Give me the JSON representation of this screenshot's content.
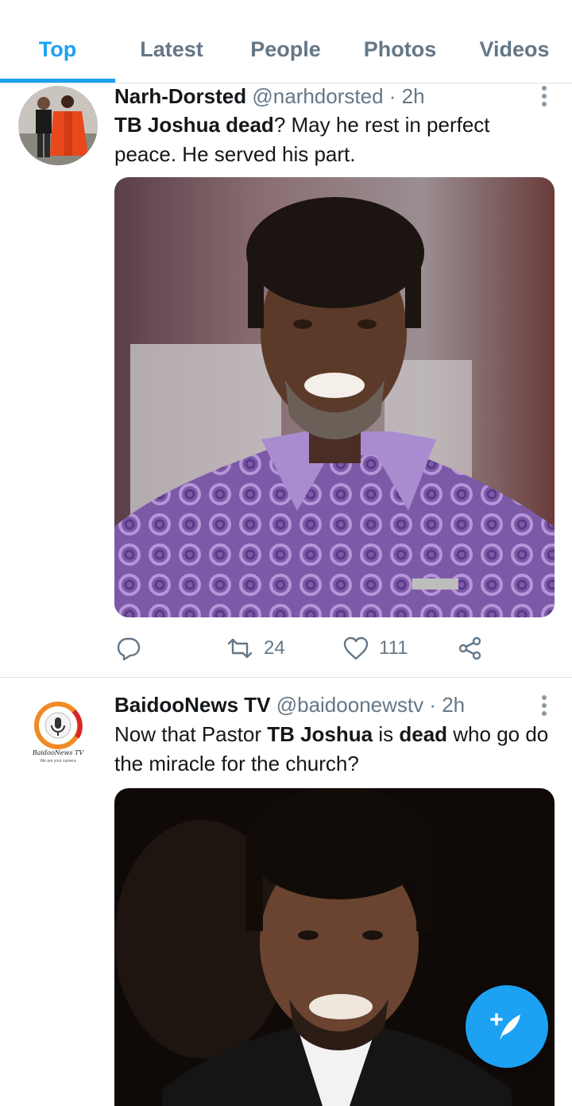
{
  "tabs": [
    {
      "label": "Top",
      "active": true
    },
    {
      "label": "Latest"
    },
    {
      "label": "People"
    },
    {
      "label": "Photos"
    },
    {
      "label": "Videos"
    }
  ],
  "tweets": [
    {
      "name": "Narh-Dorsted",
      "handle": "@narhdorsted",
      "time": "· 2h",
      "text_parts": [
        {
          "t": "TB Joshua dead",
          "bold": true
        },
        {
          "t": "? May he rest in perfect peace. He served his part.",
          "bold": false
        }
      ],
      "retweets": "24",
      "likes": "111"
    },
    {
      "name": "BaidooNews TV",
      "handle": "@baidoonewstv",
      "time": "· 2h",
      "avatar_logo_text": "BaidooNews TV",
      "avatar_tagline": "We are your camera",
      "text_parts": [
        {
          "t": "Now that Pastor ",
          "bold": false
        },
        {
          "t": "TB Joshua",
          "bold": true
        },
        {
          "t": " is ",
          "bold": false
        },
        {
          "t": "dead",
          "bold": true
        },
        {
          "t": " who go do the miracle for the church?",
          "bold": false
        }
      ]
    }
  ],
  "colors": {
    "accent": "#1da1f2",
    "muted": "#657786",
    "divider": "#dde3e8"
  },
  "icons": [
    "reply-icon",
    "retweet-icon",
    "like-icon",
    "share-icon",
    "more-icon",
    "compose-tweet-icon"
  ]
}
